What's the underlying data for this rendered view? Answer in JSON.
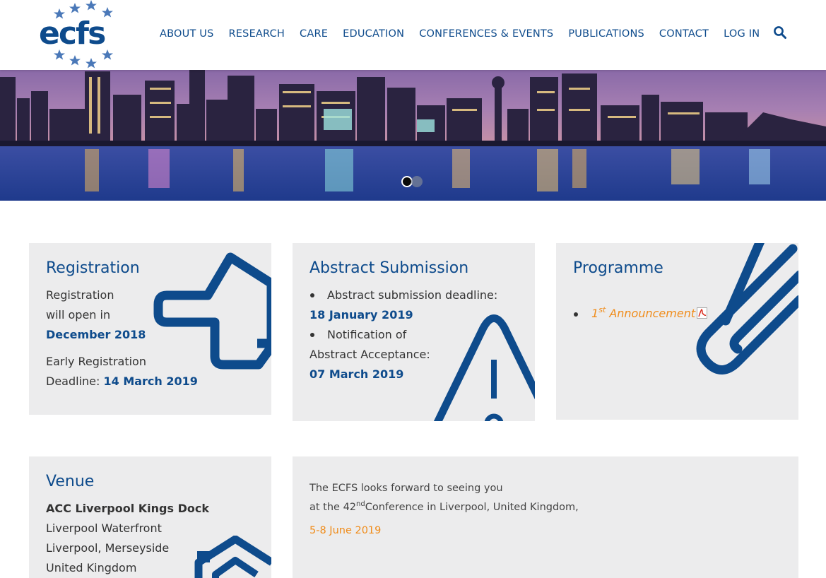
{
  "header": {
    "logo_text": "ecfs",
    "nav": [
      "ABOUT US",
      "RESEARCH",
      "CARE",
      "EDUCATION",
      "CONFERENCES & EVENTS",
      "PUBLICATIONS",
      "CONTACT",
      "LOG IN"
    ],
    "search_icon": "search-icon"
  },
  "hero": {
    "slides_count": 2,
    "active_slide": 1
  },
  "registration": {
    "title": "Registration",
    "line1": "Registration",
    "line2": "will open in",
    "open_date": "December 2018",
    "early_label_1": "Early Registration",
    "early_label_2": "Deadline: ",
    "early_date": "14 March 2019"
  },
  "abstract": {
    "title": "Abstract Submission",
    "item1_label": "Abstract submission deadline:",
    "item1_date": "18 January 2019",
    "item2_label_1": "Notification of",
    "item2_label_2": "Abstract Acceptance:",
    "item2_date": "07 March 2019"
  },
  "programme": {
    "title": "Programme",
    "link_num": "1",
    "link_sup": "st",
    "link_text": " Announcement",
    "link_icon": "pdf-icon"
  },
  "venue": {
    "title": "Venue",
    "name": "ACC Liverpool Kings Dock",
    "line1": "Liverpool Waterfront",
    "line2": "Liverpool, Merseyside",
    "line3": "United Kingdom"
  },
  "message": {
    "line1": "The ECFS looks forward to seeing you",
    "line2_a": "at the 42",
    "line2_sup": "nd",
    "line2_b": "Conference in Liverpool, United Kingdom,",
    "dates": "5-8 June 2019"
  },
  "colors": {
    "brand_blue": "#0e4b8c",
    "accent_orange": "#f08c1a",
    "card_bg": "#ececed"
  }
}
